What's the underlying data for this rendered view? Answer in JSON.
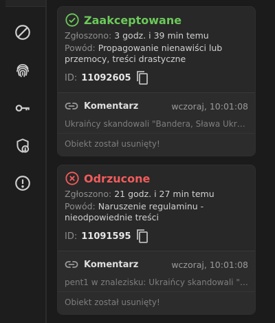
{
  "sidebar": {
    "icons": [
      "ban-icon",
      "fingerprint-icon",
      "key-icon",
      "shield-alert-icon",
      "alert-circle-icon"
    ]
  },
  "reports": [
    {
      "status": "Zaakceptowane",
      "status_color": "#6cc95a",
      "reported_label": "Zgłoszono:",
      "reported_value": "3 godz. i 39 min temu",
      "reason_label": "Powód:",
      "reason_value": "Propagowanie nienawiści lub przemocy, treści drastyczne",
      "id_label": "ID:",
      "id_value": "11092605",
      "comment": {
        "title": "Komentarz",
        "time": "wczoraj, 10:01:08",
        "excerpt": "Ukraińcy skandowali \"Bandera, Sława Ukraini...",
        "removed": "Obiekt został usunięty!"
      }
    },
    {
      "status": "Odrzucone",
      "status_color": "#f25c5c",
      "reported_label": "Zgłoszono:",
      "reported_value": "21 godz. i 27 min temu",
      "reason_label": "Powód:",
      "reason_value": "Naruszenie regulaminu - nieodpowiednie treści",
      "id_label": "ID:",
      "id_value": "11091595",
      "comment": {
        "title": "Komentarz",
        "time": "wczoraj, 10:01:08",
        "excerpt": "pent1 w znalezisku: Ukraińcy skandowali \"Ba...",
        "removed": "Obiekt został usunięty!"
      }
    }
  ]
}
